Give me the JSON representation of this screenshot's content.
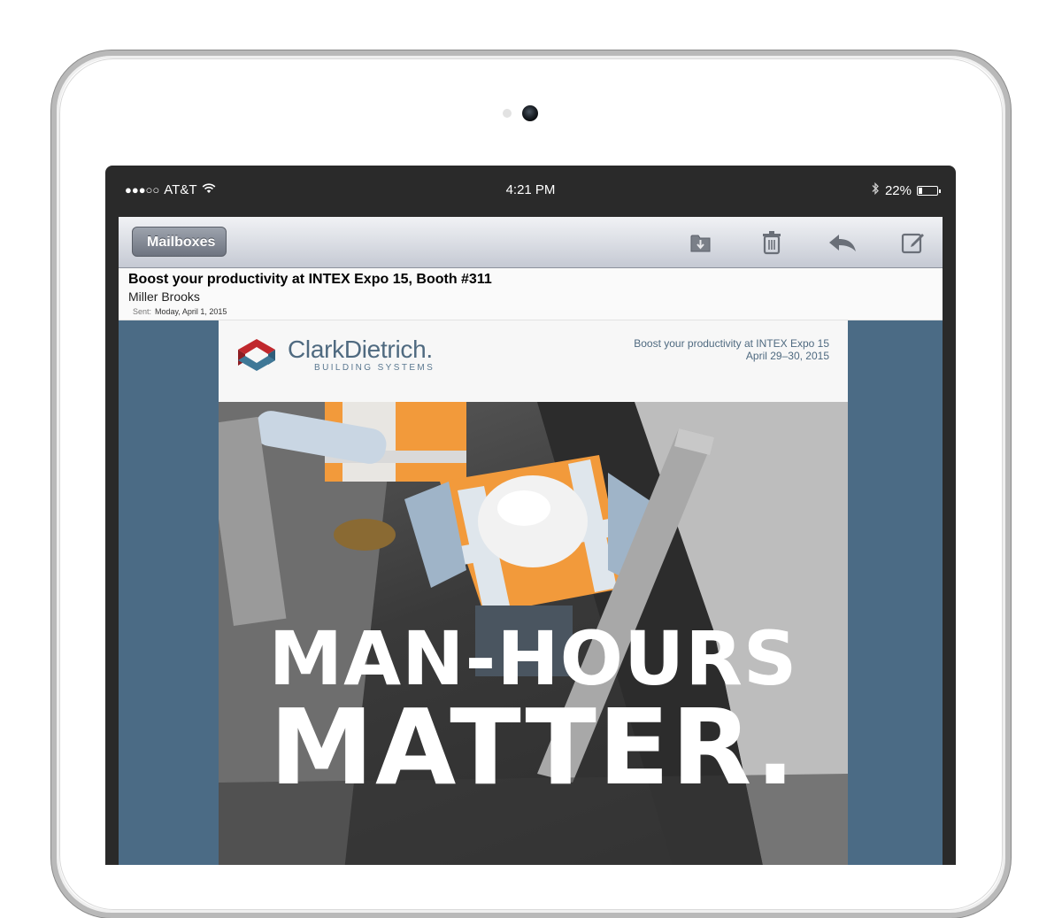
{
  "status_bar": {
    "signal": "●●●○○",
    "carrier": "AT&T",
    "time": "4:21 PM",
    "battery_percent": "22%",
    "battery_level": 0.22
  },
  "nav": {
    "back_label": "Mailboxes",
    "icons": [
      "move-to-folder-icon",
      "trash-icon",
      "reply-icon",
      "compose-icon"
    ]
  },
  "message": {
    "subject": "Boost your productivity at INTEX Expo 15, Booth #311",
    "from": "Miller Brooks",
    "sent_label": "Sent:",
    "sent_date": "Moday, April 1, 2015"
  },
  "email": {
    "logo_name": "ClarkDietrich.",
    "logo_sub": "BUILDING SYSTEMS",
    "promo_line1": "Boost your productivity at INTEX Expo 15",
    "promo_line2": "April 29–30, 2015",
    "headline1": "MAN-HOURS",
    "headline2": "MATTER.",
    "colors": {
      "side_panel": "#4b6b85",
      "brand_blue": "#4f6a80",
      "brand_red": "#c0282d"
    }
  }
}
